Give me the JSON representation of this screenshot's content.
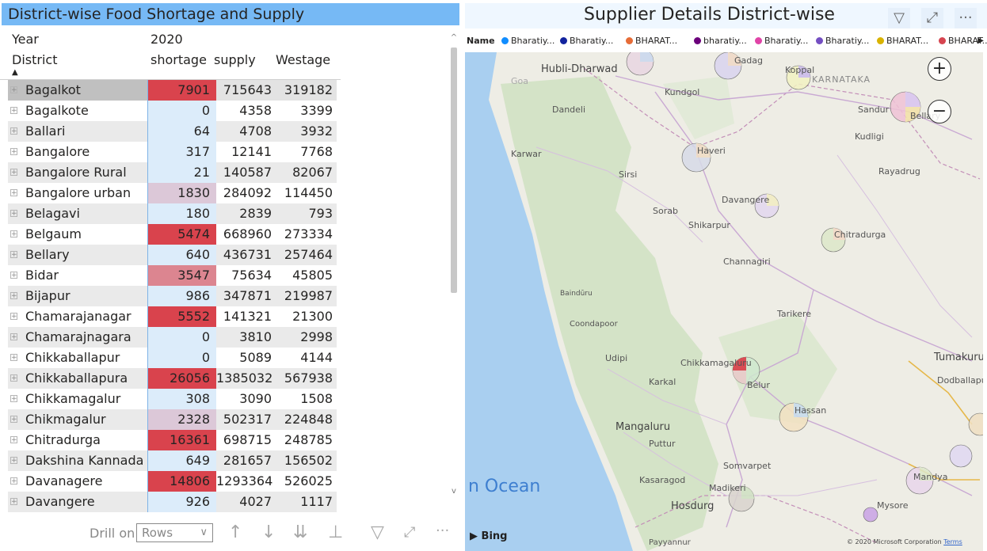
{
  "table_visual": {
    "title": "District-wise Food Shortage and Supply",
    "year_label": "Year",
    "year_value": "2020",
    "columns": {
      "district": "District",
      "shortage": "shortage",
      "supply": "supply",
      "westage": "Westage"
    },
    "rows": [
      {
        "district": "Bagalkot",
        "shortage": "7901",
        "supply": "715643",
        "westage": "319182"
      },
      {
        "district": "Bagalkote",
        "shortage": "0",
        "supply": "4358",
        "westage": "3399"
      },
      {
        "district": "Ballari",
        "shortage": "64",
        "supply": "4708",
        "westage": "3932"
      },
      {
        "district": "Bangalore",
        "shortage": "317",
        "supply": "12141",
        "westage": "7768"
      },
      {
        "district": "Bangalore Rural",
        "shortage": "21",
        "supply": "140587",
        "westage": "82067"
      },
      {
        "district": "Bangalore urban",
        "shortage": "1830",
        "supply": "284092",
        "westage": "114450"
      },
      {
        "district": "Belagavi",
        "shortage": "180",
        "supply": "2839",
        "westage": "793"
      },
      {
        "district": "Belgaum",
        "shortage": "5474",
        "supply": "668960",
        "westage": "273334"
      },
      {
        "district": "Bellary",
        "shortage": "640",
        "supply": "436731",
        "westage": "257464"
      },
      {
        "district": "Bidar",
        "shortage": "3547",
        "supply": "75634",
        "westage": "45805"
      },
      {
        "district": "Bijapur",
        "shortage": "986",
        "supply": "347871",
        "westage": "219987"
      },
      {
        "district": "Chamarajanagar",
        "shortage": "5552",
        "supply": "141321",
        "westage": "21300"
      },
      {
        "district": "Chamarajnagara",
        "shortage": "0",
        "supply": "3810",
        "westage": "2998"
      },
      {
        "district": "Chikkaballapur",
        "shortage": "0",
        "supply": "5089",
        "westage": "4144"
      },
      {
        "district": "Chikkaballapura",
        "shortage": "26056",
        "supply": "1385032",
        "westage": "567938"
      },
      {
        "district": "Chikkamagalur",
        "shortage": "308",
        "supply": "3090",
        "westage": "1508"
      },
      {
        "district": "Chikmagalur",
        "shortage": "2328",
        "supply": "502317",
        "westage": "224848"
      },
      {
        "district": "Chitradurga",
        "shortage": "16361",
        "supply": "698715",
        "westage": "248785"
      },
      {
        "district": "Dakshina Kannada",
        "shortage": "649",
        "supply": "281657",
        "westage": "156502"
      },
      {
        "district": "Davanagere",
        "shortage": "14806",
        "supply": "1293364",
        "westage": "526025"
      },
      {
        "district": "Davangere",
        "shortage": "926",
        "supply": "4027",
        "westage": "1117"
      }
    ],
    "footer": {
      "drill_label": "Drill on",
      "drill_value": "Rows"
    }
  },
  "map_visual": {
    "title": "Supplier Details District-wise",
    "legend_title": "Name",
    "legend": [
      {
        "label": "Bharatiy...",
        "color": "#118dff"
      },
      {
        "label": "Bharatiy...",
        "color": "#12239e"
      },
      {
        "label": "BHARAT...",
        "color": "#e66c37"
      },
      {
        "label": "bharatiy...",
        "color": "#6b007b"
      },
      {
        "label": "Bharatiy...",
        "color": "#e044a7"
      },
      {
        "label": "Bharatiy...",
        "color": "#744ec2"
      },
      {
        "label": "BHARAT...",
        "color": "#d9b300"
      },
      {
        "label": "BHARAT...",
        "color": "#d64550"
      }
    ],
    "places": [
      "Hubli-Dharwad",
      "Gadag",
      "Koppal",
      "KARNATAKA",
      "Kundgol",
      "Dandeli",
      "Sandur",
      "Bellary",
      "Kudligi",
      "Karwar",
      "Haveri",
      "Sirsi",
      "Rayadrug",
      "Davangere",
      "Sorab",
      "Shikarpur",
      "Chitradurga",
      "Channagiri",
      "Baindūru",
      "Tarikere",
      "Coondapoor",
      "Udipi",
      "Chikkamagaluru",
      "Tumakuru",
      "Karkal",
      "Belur",
      "Dodballapur",
      "Hassan",
      "Mangaluru",
      "Puttur",
      "Somvarpet",
      "Kasaragod",
      "Madikeri",
      "Mandya",
      "Hosdurg",
      "Mysore",
      "Payyannur",
      "Goa"
    ],
    "ocean_label": "n Ocean",
    "bing_label": "Bing",
    "copyright": "© 2020 Microsoft Corporation",
    "terms": "Terms"
  }
}
